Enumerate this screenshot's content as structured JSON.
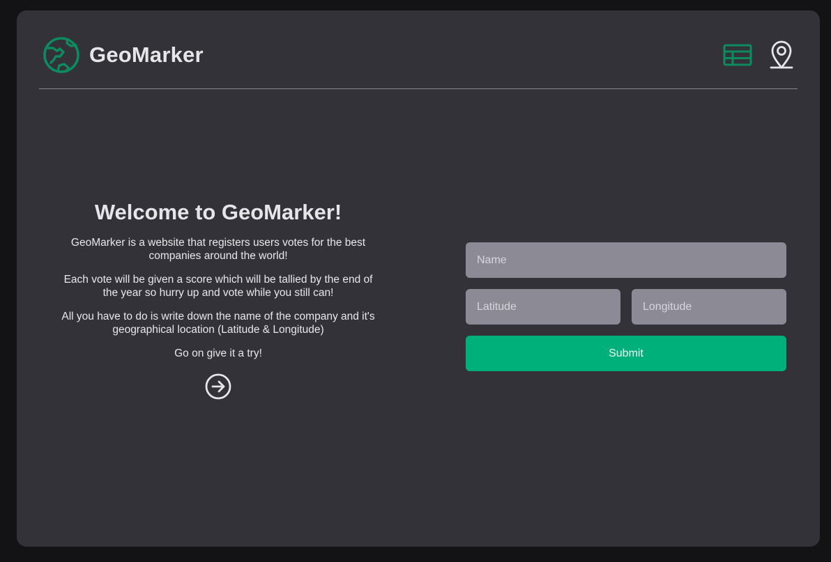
{
  "header": {
    "brand": "GeoMarker",
    "logo_icon": "globe-icon",
    "nav": [
      {
        "icon": "table-icon",
        "color": "#0d8a5f",
        "active": true
      },
      {
        "icon": "map-pin-icon",
        "color": "#e6e6ea",
        "active": false
      }
    ]
  },
  "intro": {
    "title": "Welcome to GeoMarker!",
    "paragraphs": [
      "GeoMarker is a website that registers users votes for the best companies around the world!",
      "Each vote will be given a score which will be tallied by the end of the year so hurry up and vote while you still can!",
      "All you have to do is write down the name of the company and it's geographical location (Latitude & Longitude)",
      "Go on give it a try!"
    ],
    "arrow_icon": "arrow-right-circle-icon"
  },
  "form": {
    "name_placeholder": "Name",
    "latitude_placeholder": "Latitude",
    "longitude_placeholder": "Longitude",
    "submit_label": "Submit"
  },
  "colors": {
    "background": "#131315",
    "card": "#333238",
    "accent": "#00b07b",
    "logo_green": "#0d8a5f",
    "input": "#8c8b95"
  }
}
